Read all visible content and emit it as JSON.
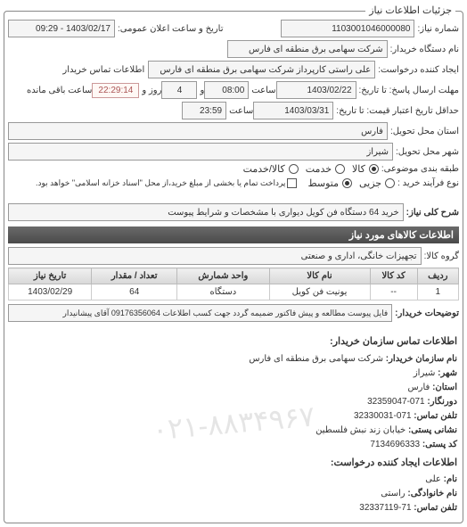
{
  "legend": "جزئیات اطلاعات نیاز",
  "fields": {
    "need_no_label": "شماره نیاز:",
    "need_no": "1103001046000080",
    "pub_datetime_label": "تاریخ و ساعت اعلان عمومی:",
    "pub_datetime": "1403/02/17 - 09:29",
    "buyer_name_label": "نام دستگاه خریدار:",
    "buyer_name": "شرکت سهامی برق منطقه ای فارس",
    "req_creator_label": "ایجاد کننده درخواست:",
    "req_creator": "علی راستی کارپرداز شرکت سهامی برق منطقه ای فارس",
    "buyer_contact_label": "اطلاعات تماس خریدار",
    "deadline_to_label": "مهلت ارسال پاسخ: تا تاریخ:",
    "deadline_to_date": "1403/02/22",
    "time_label": "ساعت",
    "deadline_to_time": "08:00",
    "and_label": "و",
    "days_field": "4",
    "days_label": "روز و",
    "remaining_time": "22:29:14",
    "remaining_label": "ساعت باقی مانده",
    "valid_until_label": "حداقل تاریخ اعتبار قیمت: تا تاریخ:",
    "valid_until_date": "1403/03/31",
    "valid_until_time": "23:59",
    "province_label": "استان محل تحویل:",
    "province": "فارس",
    "city_label": "شهر محل تحویل:",
    "city": "شیراز",
    "nature_label": "طبقه بندی موضوعی:",
    "nature_goods": "کالا",
    "nature_service": "خدمت",
    "nature_both": "کالا/خدمت",
    "buy_type_label": "نوع فرآیند خرید :",
    "buy_type_partial": "جزیی",
    "buy_type_medium": "متوسط",
    "buy_note": "پرداخت تمام یا بخشی از مبلغ خرید،از محل \"اسناد خزانه اسلامی\" خواهد بود.",
    "desc_label": "شرح کلی نیاز:",
    "desc_value": "خرید 64 دستگاه فن کویل دیواری با مشخصات و شرایط پیوست",
    "goods_header": "اطلاعات کالاهای مورد نیاز",
    "group_label": "گروه کالا:",
    "group_value": "تجهیزات خانگی، اداری و صنعتی",
    "table": {
      "headers": [
        "ردیف",
        "کد کالا",
        "نام کالا",
        "واحد شمارش",
        "تعداد / مقدار",
        "تاریخ نیاز"
      ],
      "row": [
        "1",
        "--",
        "یونیت فن کویل",
        "دستگاه",
        "64",
        "1403/02/29"
      ]
    },
    "buyer_notes_label": "توضیحات خریدار:",
    "buyer_notes": "فایل پیوست مطالعه و پیش فاکتور ضمیمه گردد جهت کسب اطلاعات 09176356064 آقای پیشانیدار",
    "contact_header": "اطلاعات تماس سازمان خریدار:",
    "contact_org_label": "نام سازمان خریدار:",
    "contact_org": "شرکت سهامی برق منطقه ای فارس",
    "contact_city_label": "شهر:",
    "contact_city": "شیراز",
    "contact_province_label": "استان:",
    "contact_province": "فارس",
    "fax_label": "دورنگار:",
    "fax": "071-32359047",
    "phone_label": "تلفن تماس:",
    "phone": "071-32330031",
    "postal_addr_label": "نشانی پستی:",
    "postal_addr": "خیابان زند نبش فلسطین",
    "postal_code_label": "کد پستی:",
    "postal_code": "7134696333",
    "creator_header": "اطلاعات ایجاد کننده درخواست:",
    "fname_label": "نام:",
    "fname": "علی",
    "lname_label": "نام خانوادگی:",
    "lname": "راستی",
    "creator_phone_label": "تلفن تماس:",
    "creator_phone": "71-32337119",
    "watermark": "۰۲۱-۸۸۳۴۹۶۷"
  }
}
